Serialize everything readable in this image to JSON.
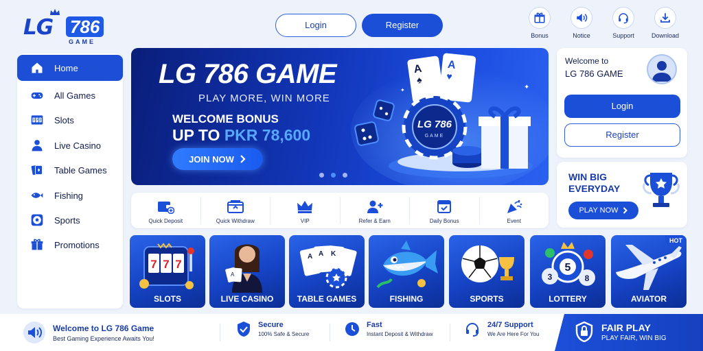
{
  "brand": {
    "logo_lg": "LG",
    "logo_num": "786",
    "logo_sub": "GAME"
  },
  "header": {
    "login_label": "Login",
    "register_label": "Register",
    "icons": [
      {
        "label": "Bonus",
        "icon": "gift-icon"
      },
      {
        "label": "Notice",
        "icon": "speaker-icon"
      },
      {
        "label": "Support",
        "icon": "headset-icon"
      },
      {
        "label": "Download",
        "icon": "download-icon"
      }
    ]
  },
  "sidebar": {
    "items": [
      {
        "label": "Home",
        "icon": "home-icon",
        "active": true
      },
      {
        "label": "All Games",
        "icon": "gamepad-icon"
      },
      {
        "label": "Slots",
        "icon": "slot-machine-icon"
      },
      {
        "label": "Live Casino",
        "icon": "dealer-icon"
      },
      {
        "label": "Table Games",
        "icon": "cards-icon"
      },
      {
        "label": "Fishing",
        "icon": "fish-icon"
      },
      {
        "label": "Sports",
        "icon": "soccer-ball-icon"
      },
      {
        "label": "Promotions",
        "icon": "gift-icon"
      }
    ]
  },
  "banner": {
    "title": "LG 786 GAME",
    "tagline": "PLAY MORE, WIN MORE",
    "bonus_line1": "WELCOME BONUS",
    "bonus_prefix": "UP TO ",
    "bonus_amount": "PKR 78,600",
    "cta_label": "JOIN NOW",
    "chip_label": "LG 786",
    "chip_sub": "GAME",
    "carousel_active_index": 1,
    "carousel_count": 3
  },
  "welcome_panel": {
    "greeting": "Welcome to",
    "site_name": "LG 786 GAME",
    "login_label": "Login",
    "register_label": "Register"
  },
  "promo_panel": {
    "headline_line1": "WIN BIG",
    "headline_line2": "EVERYDAY",
    "cta_label": "PLAY NOW"
  },
  "quick_actions": [
    {
      "label": "Quick Deposit",
      "icon": "wallet-plus-icon"
    },
    {
      "label": "Quick Withdraw",
      "icon": "wallet-out-icon"
    },
    {
      "label": "VIP",
      "icon": "crown-icon"
    },
    {
      "label": "Refer & Earn",
      "icon": "user-plus-icon"
    },
    {
      "label": "Daily Bonus",
      "icon": "calendar-check-icon"
    },
    {
      "label": "Event",
      "icon": "party-popper-icon"
    }
  ],
  "game_cards": [
    {
      "label": "SLOTS",
      "icon": "slot-machine-icon"
    },
    {
      "label": "LIVE CASINO",
      "icon": "dealer-icon"
    },
    {
      "label": "TABLE GAMES",
      "icon": "cards-icon"
    },
    {
      "label": "FISHING",
      "icon": "fish-icon"
    },
    {
      "label": "SPORTS",
      "icon": "soccer-ball-icon"
    },
    {
      "label": "LOTTERY",
      "icon": "lottery-balls-icon"
    },
    {
      "label": "AVIATOR",
      "icon": "airplane-icon",
      "badge": "HOT"
    }
  ],
  "footer": {
    "welcome_title": "Welcome to LG 786 Game",
    "welcome_sub": "Best Gaming Experience Awaits You!",
    "features": [
      {
        "title": "Secure",
        "sub": "100% Safe & Secure",
        "icon": "shield-check-icon"
      },
      {
        "title": "Fast",
        "sub": "Instant Deposit & Withdraw",
        "icon": "clock-icon"
      },
      {
        "title": "24/7 Support",
        "sub": "We Are Here For You",
        "icon": "headset-icon"
      }
    ],
    "fair_title": "FAIR PLAY",
    "fair_sub": "PLAY FAIR, WIN BIG"
  },
  "colors": {
    "primary": "#1c4fd8",
    "dark": "#0f1b4d",
    "background": "#eef3fb",
    "accent": "#59a8ff"
  }
}
